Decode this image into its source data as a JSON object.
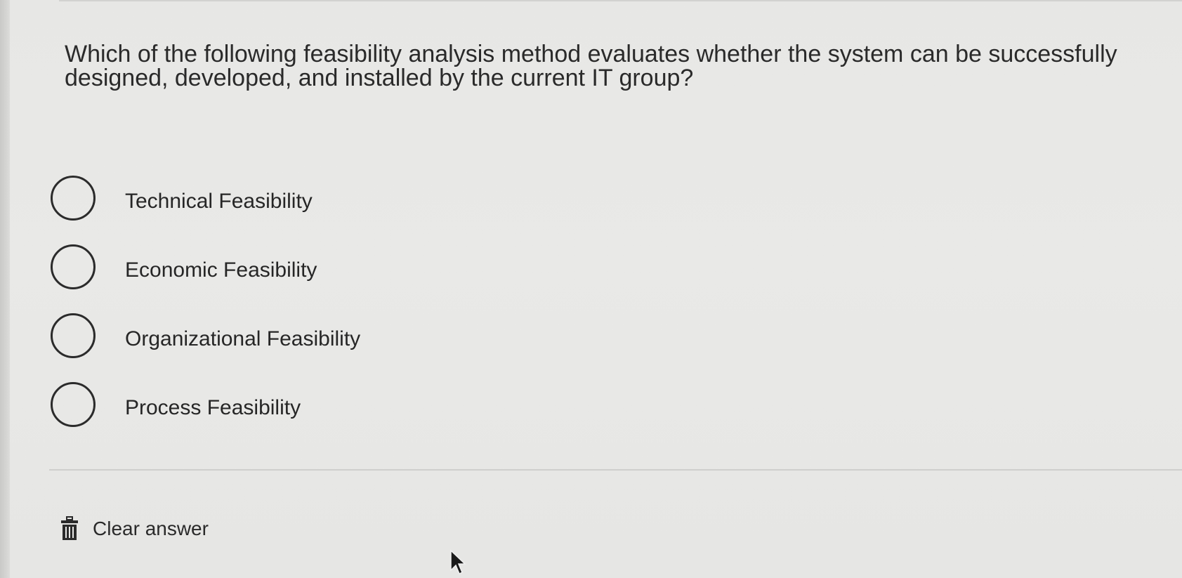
{
  "question": {
    "text": "Which of the following feasibility analysis method evaluates whether the system can be successfully designed, developed, and installed by the current IT group?"
  },
  "options": [
    {
      "label": "Technical Feasibility",
      "selected": false
    },
    {
      "label": "Economic Feasibility",
      "selected": false
    },
    {
      "label": "Organizational Feasibility",
      "selected": false
    },
    {
      "label": "Process Feasibility",
      "selected": false
    }
  ],
  "clear_answer": {
    "label": "Clear answer",
    "icon": "trash-icon"
  },
  "colors": {
    "background": "#e8e8e6",
    "text": "#262626",
    "radio_border": "#2b2b2b"
  }
}
